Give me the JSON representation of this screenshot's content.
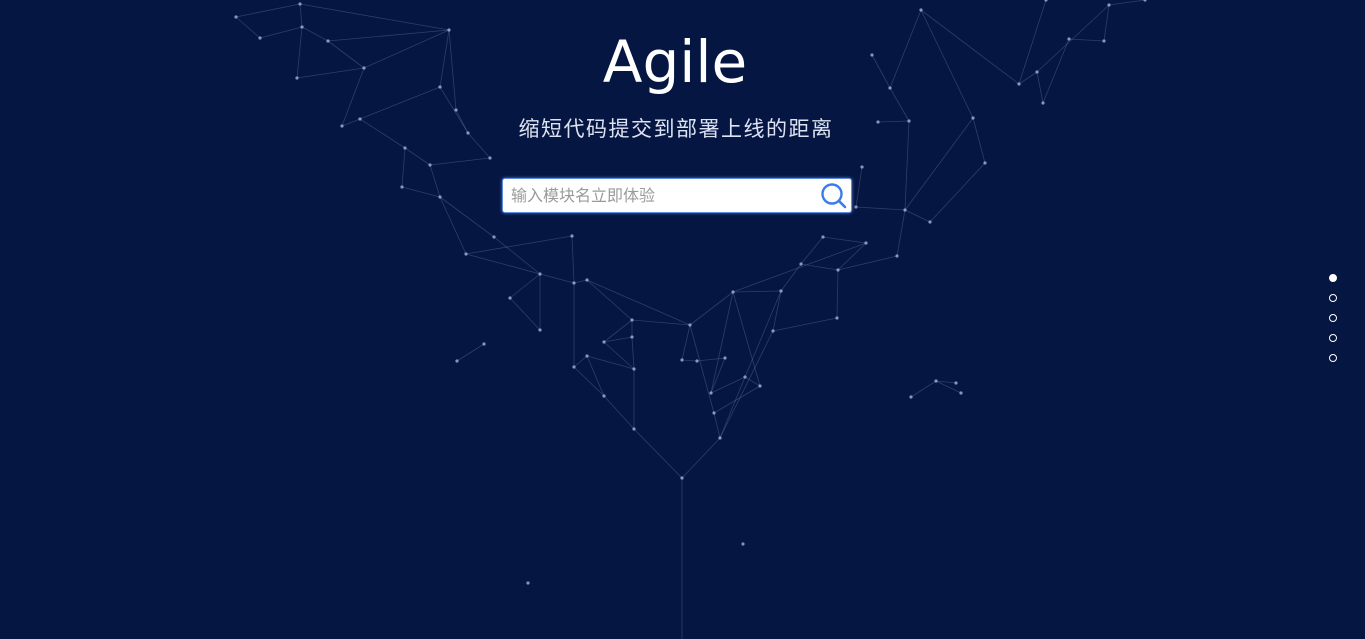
{
  "hero": {
    "title": "Agile",
    "subtitle": "缩短代码提交到部署上线的距离"
  },
  "search": {
    "placeholder": "输入模块名立即体验",
    "value": "",
    "icon": "search-icon"
  },
  "pagination": {
    "count": 5,
    "active_index": 0
  },
  "colors": {
    "background": "#061642",
    "accent": "#3b7de8",
    "text": "#ffffff"
  }
}
